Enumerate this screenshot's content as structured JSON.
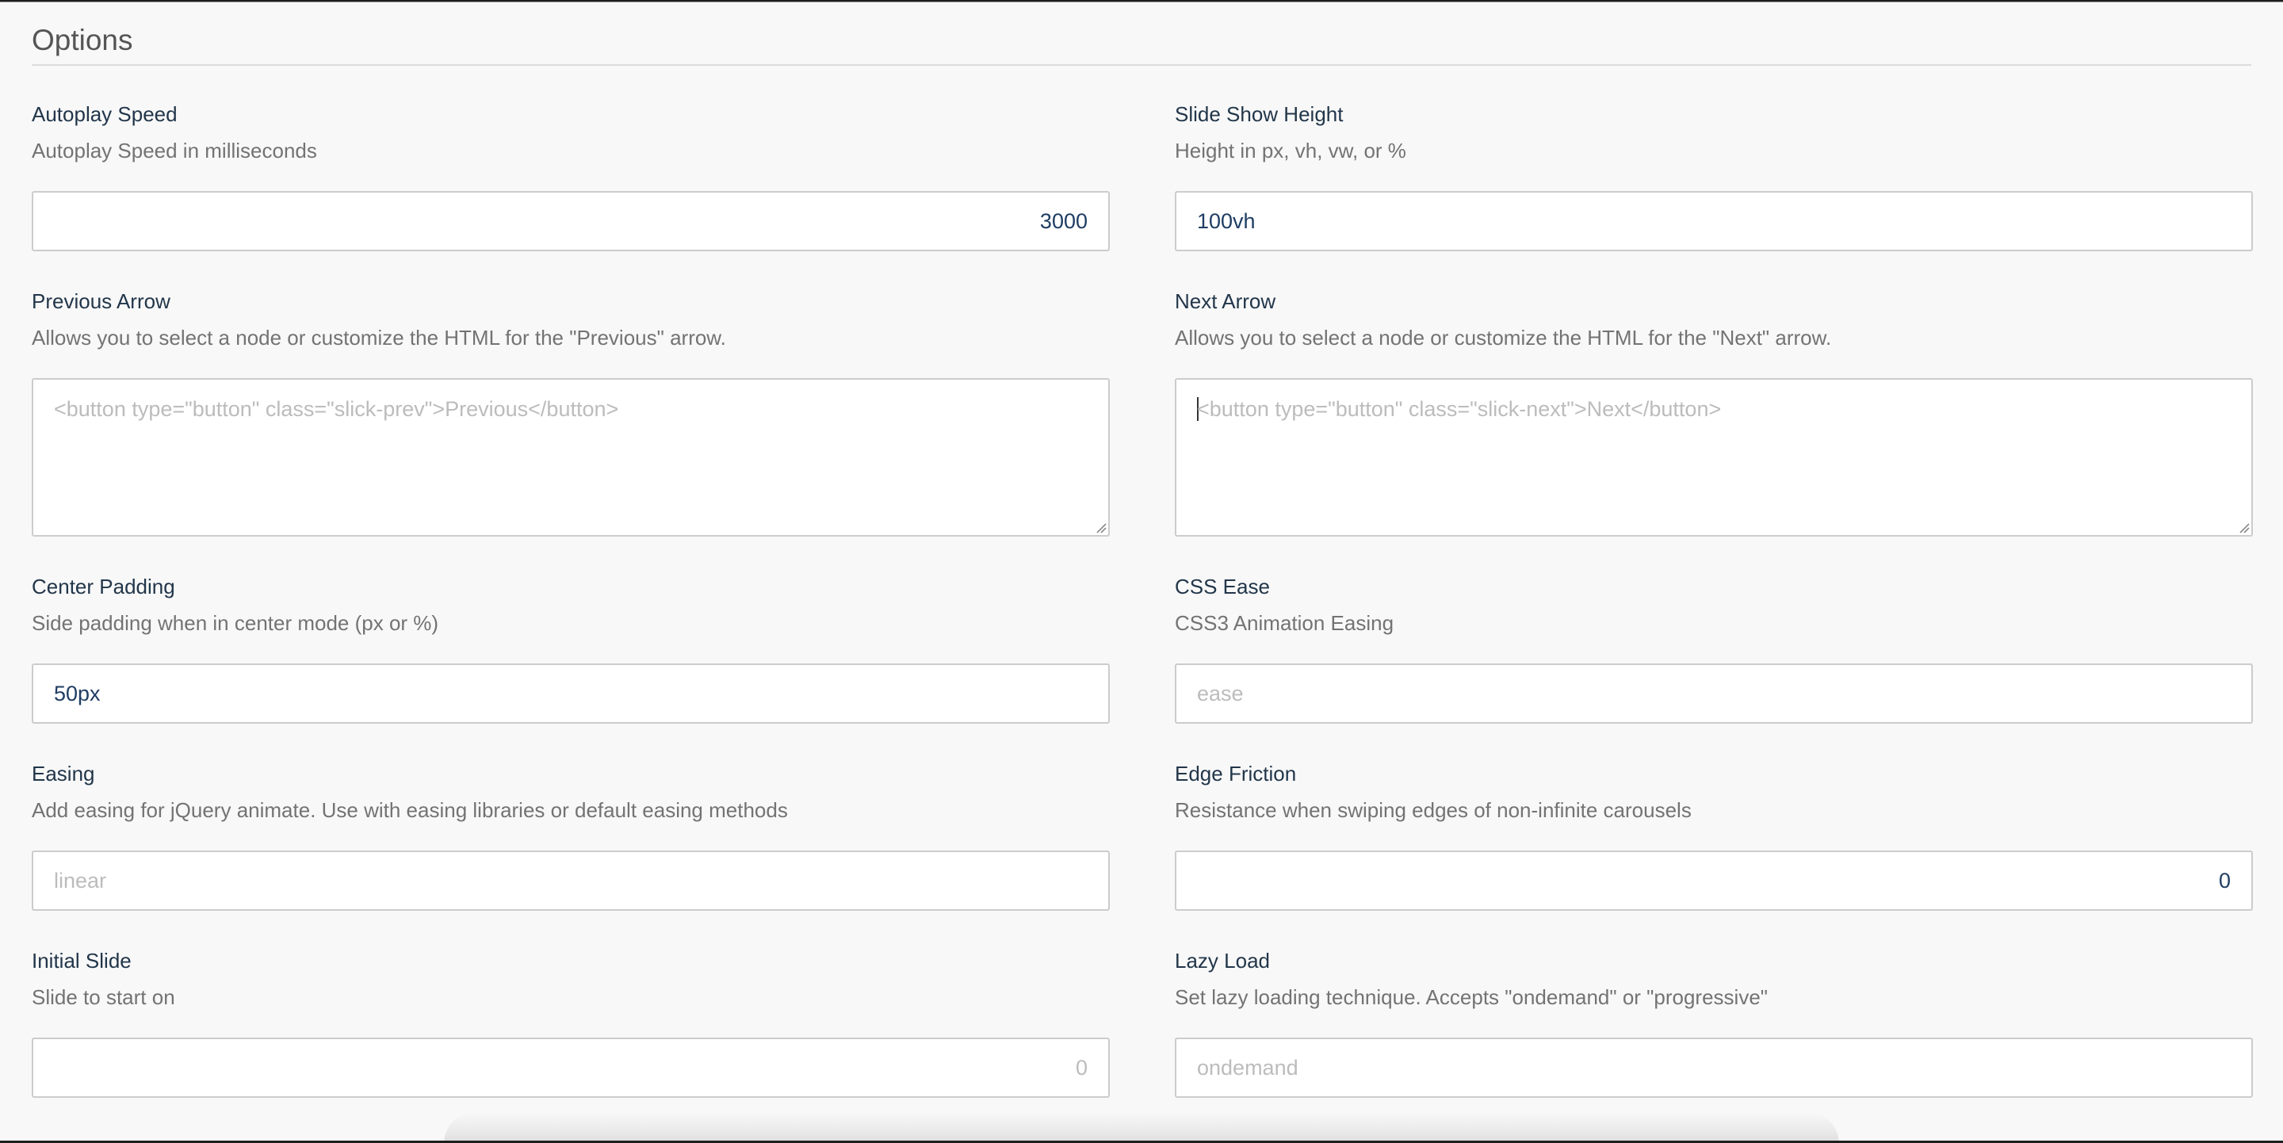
{
  "section": {
    "title": "Options"
  },
  "fields": {
    "autoplay_speed": {
      "label": "Autoplay Speed",
      "help": "Autoplay Speed in milliseconds",
      "value": "3000"
    },
    "slide_show_height": {
      "label": "Slide Show Height",
      "help": "Height in px, vh, vw, or %",
      "value": "100vh"
    },
    "previous_arrow": {
      "label": "Previous Arrow",
      "help": "Allows you to select a node or customize the HTML for the \"Previous\" arrow.",
      "placeholder": "<button type=\"button\" class=\"slick-prev\">Previous</button>"
    },
    "next_arrow": {
      "label": "Next Arrow",
      "help": "Allows you to select a node or customize the HTML for the \"Next\" arrow.",
      "placeholder": "<button type=\"button\" class=\"slick-next\">Next</button>"
    },
    "center_padding": {
      "label": "Center Padding",
      "help": "Side padding when in center mode (px or %)",
      "value": "50px"
    },
    "css_ease": {
      "label": "CSS Ease",
      "help": "CSS3 Animation Easing",
      "placeholder": "ease"
    },
    "easing": {
      "label": "Easing",
      "help": "Add easing for jQuery animate. Use with easing libraries or default easing methods",
      "placeholder": "linear"
    },
    "edge_friction": {
      "label": "Edge Friction",
      "help": "Resistance when swiping edges of non-infinite carousels",
      "value": "0"
    },
    "initial_slide": {
      "label": "Initial Slide",
      "help": "Slide to start on",
      "placeholder": "0"
    },
    "lazy_load": {
      "label": "Lazy Load",
      "help": "Set lazy loading technique. Accepts \"ondemand\" or \"progressive\"",
      "placeholder": "ondemand"
    }
  },
  "colors": {
    "label": "#22364a",
    "help": "#737373",
    "value": "#1f3d63",
    "placeholder": "#bcbcbc",
    "border": "#cccccc",
    "background": "#f8f8f8"
  }
}
